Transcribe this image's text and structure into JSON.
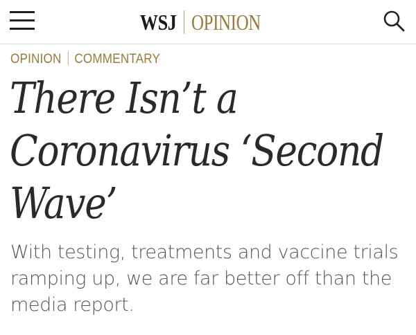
{
  "header": {
    "brand_wsj": "WSJ",
    "brand_section": "OPINION"
  },
  "icons": {
    "menu": "hamburger-menu-icon",
    "search": "search-icon"
  },
  "colors": {
    "accent_gold": "#9a7a3c",
    "headline_text": "#2a2a2a",
    "dek_text": "#555555"
  },
  "article": {
    "kicker_section": "OPINION",
    "kicker_category": "COMMENTARY",
    "headline": "There Isn’t a Coronavirus ‘Second Wave’",
    "dek": "With testing, treatments and vaccine trials ramping up, we are far better off than the media report."
  }
}
